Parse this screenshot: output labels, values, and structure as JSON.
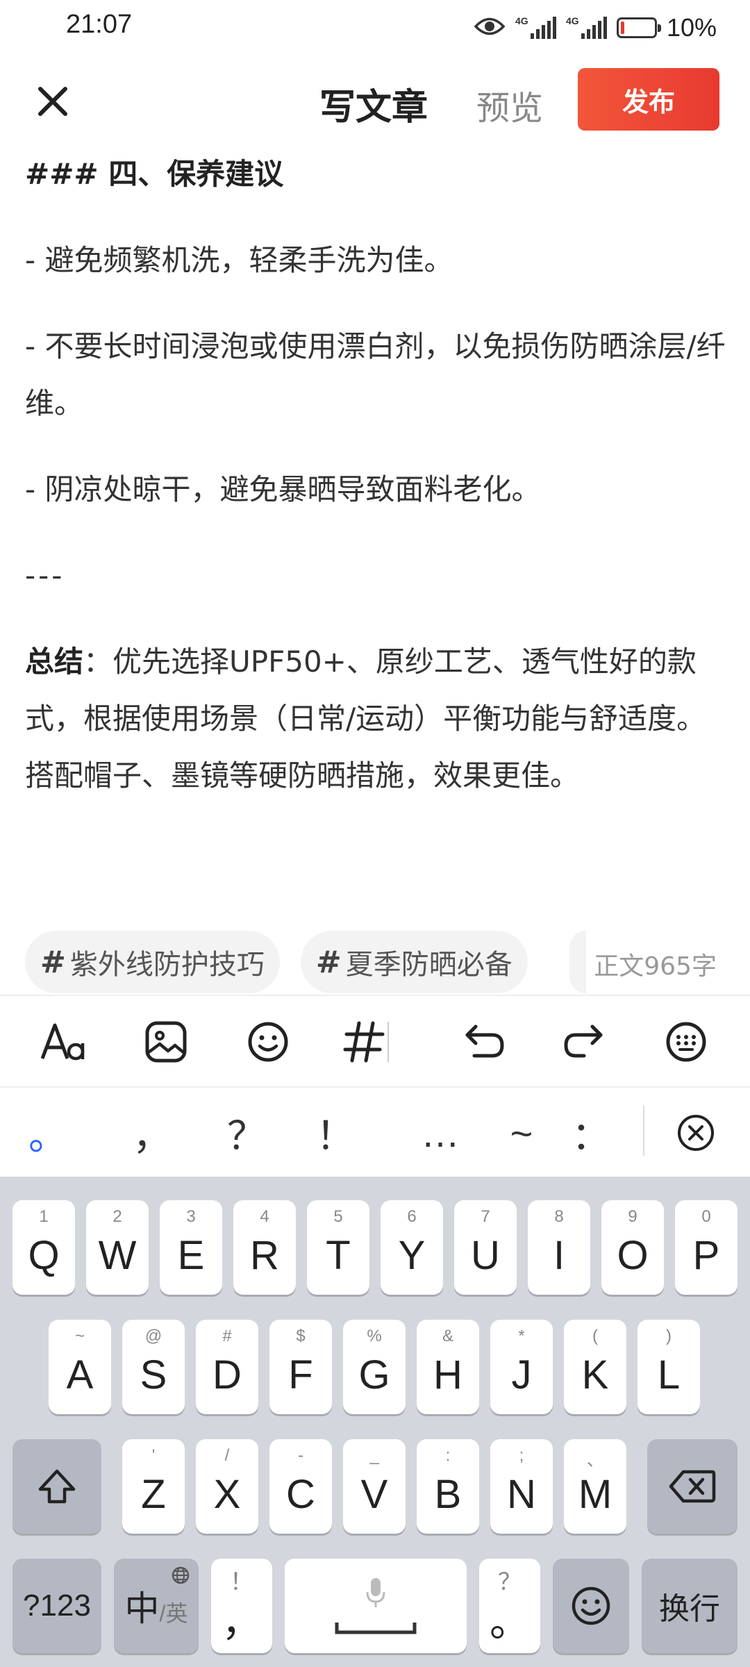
{
  "status_bar": {
    "time": "21:07",
    "network_1": "4G",
    "network_2": "4G",
    "battery_text": "10%",
    "battery_level": 0.1,
    "battery_color": "#e53935"
  },
  "header": {
    "close_icon": "close-icon",
    "title": "写文章",
    "preview": "预览",
    "publish": "发布",
    "publish_color": "#ef4a34"
  },
  "article": {
    "heading": "### 四、保养建议",
    "bullets": [
      "- 避免频繁机洗，轻柔手洗为佳。",
      "- 不要长时间浸泡或使用漂白剂，以免损伤防晒涂层/纤维。",
      "- 阴凉处晾干，避免暴晒导致面料老化。"
    ],
    "divider": "---",
    "summary_label": "总结",
    "summary_text": "：优先选择UPF50+、原纱工艺、透气性好的款式，根据使用场景（日常/运动）平衡功能与舒适度。搭配帽子、墨镜等硬防晒措施，效果更佳。"
  },
  "tags": [
    {
      "hash": "#",
      "label": "紫外线防护技巧"
    },
    {
      "hash": "#",
      "label": "夏季防晒必备"
    }
  ],
  "word_count": "正文965字",
  "toolbar": {
    "items": [
      "font-size-icon",
      "image-icon",
      "emoji-icon",
      "topic-hash-icon",
      "undo-icon",
      "redo-icon",
      "keyboard-icon"
    ],
    "hash_glyph": "#"
  },
  "punctuation": [
    "。",
    "，",
    "？",
    "！",
    "…",
    "~",
    "："
  ],
  "keyboard": {
    "row1": [
      {
        "sub": "1",
        "key": "Q"
      },
      {
        "sub": "2",
        "key": "W"
      },
      {
        "sub": "3",
        "key": "E"
      },
      {
        "sub": "4",
        "key": "R"
      },
      {
        "sub": "5",
        "key": "T"
      },
      {
        "sub": "6",
        "key": "Y"
      },
      {
        "sub": "7",
        "key": "U"
      },
      {
        "sub": "8",
        "key": "I"
      },
      {
        "sub": "9",
        "key": "O"
      },
      {
        "sub": "0",
        "key": "P"
      }
    ],
    "row2": [
      {
        "sub": "~",
        "key": "A"
      },
      {
        "sub": "@",
        "key": "S"
      },
      {
        "sub": "#",
        "key": "D"
      },
      {
        "sub": "$",
        "key": "F"
      },
      {
        "sub": "%",
        "key": "G"
      },
      {
        "sub": "&",
        "key": "H"
      },
      {
        "sub": "*",
        "key": "J"
      },
      {
        "sub": "(",
        "key": "K"
      },
      {
        "sub": ")",
        "key": "L"
      }
    ],
    "row3": [
      {
        "sub": "'",
        "key": "Z"
      },
      {
        "sub": "/",
        "key": "X"
      },
      {
        "sub": "-",
        "key": "C"
      },
      {
        "sub": "_",
        "key": "V"
      },
      {
        "sub": ":",
        "key": "B"
      },
      {
        "sub": ";",
        "key": "N"
      },
      {
        "sub": "、",
        "key": "M"
      }
    ],
    "numbers": "?123",
    "lang_main": "中",
    "lang_sub": "/英",
    "comma_sub": "！",
    "comma": "，",
    "period_sub": "？",
    "period": "。",
    "enter": "换行"
  }
}
